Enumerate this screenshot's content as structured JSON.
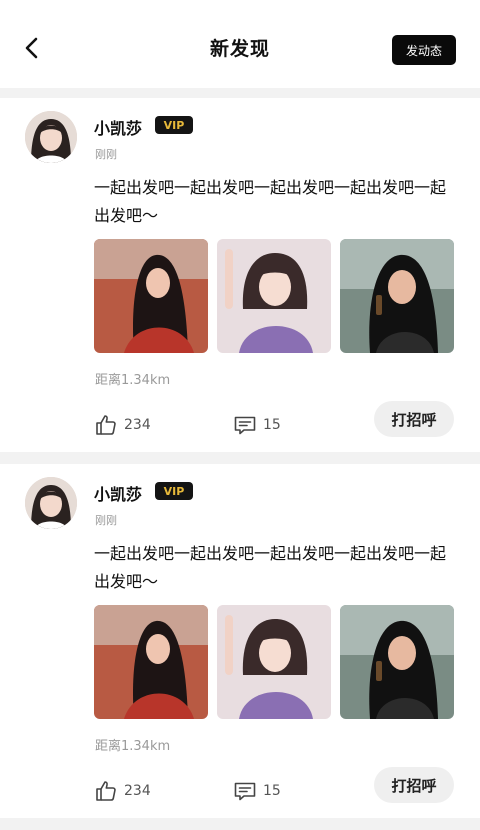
{
  "header": {
    "title": "新发现",
    "post_label": "发动态"
  },
  "posts": [
    {
      "username": "小凯莎",
      "badge": "VIP",
      "time": "刚刚",
      "content": "一起出发吧一起出发吧一起出发吧一起出发吧一起出发吧～",
      "distance": "距离1.34km",
      "likes": "234",
      "comments": "15",
      "greet_label": "打招呼"
    },
    {
      "username": "小凯莎",
      "badge": "VIP",
      "time": "刚刚",
      "content": "一起出发吧一起出发吧一起出发吧一起出发吧一起出发吧～",
      "distance": "距离1.34km",
      "likes": "234",
      "comments": "15",
      "greet_label": "打招呼"
    }
  ],
  "colors": {
    "vip_bg": "#141414",
    "vip_text": "#e7b93a",
    "post_button_bg": "#0a0a0a"
  },
  "icons": [
    "back-arrow-icon",
    "like-icon",
    "comment-icon"
  ]
}
